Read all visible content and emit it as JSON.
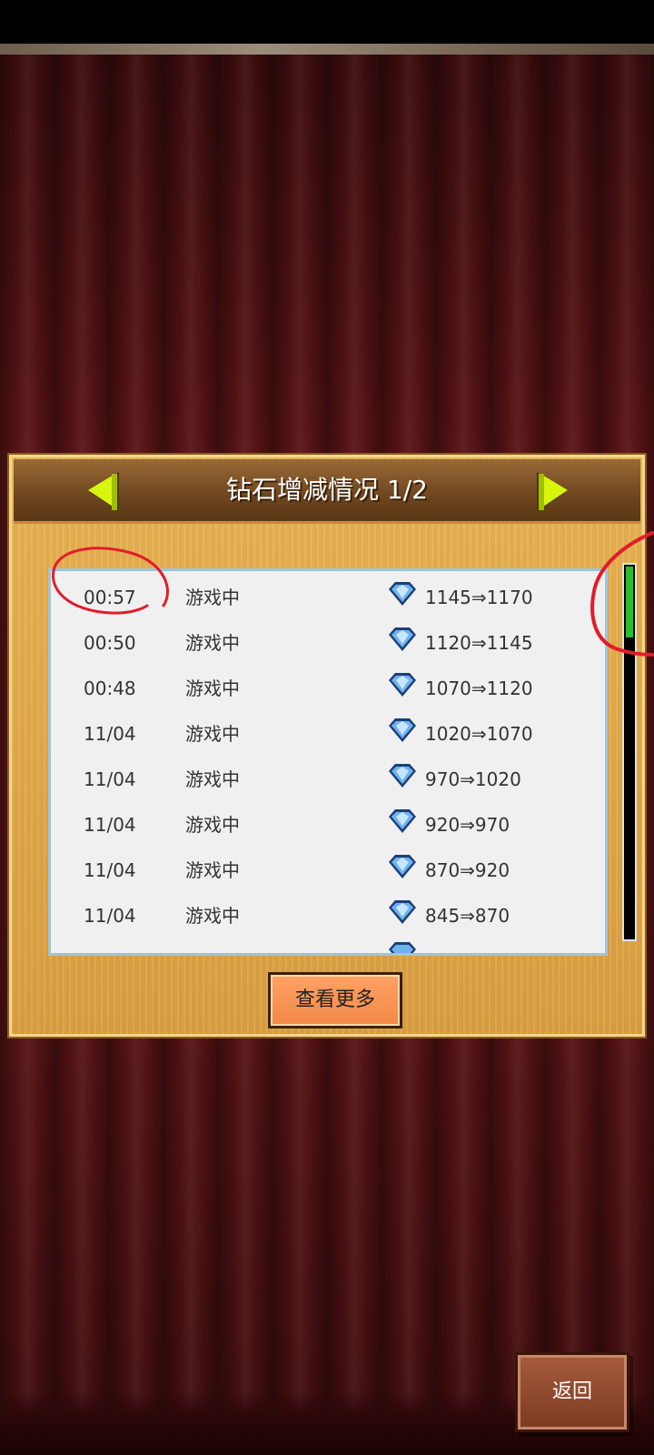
{
  "colors": {
    "accent_green": "#26c12c",
    "button_orange": "#f28a48",
    "annotation_red": "#e11d2a"
  },
  "panel": {
    "title": "钻石增减情况 1/2",
    "prev_icon": "arrow-left-icon",
    "next_icon": "arrow-right-icon"
  },
  "rows": [
    {
      "time": "00:57",
      "status": "游戏中",
      "icon": "diamond-icon",
      "change": "1145⇒1170"
    },
    {
      "time": "00:50",
      "status": "游戏中",
      "icon": "diamond-icon",
      "change": "1120⇒1145"
    },
    {
      "time": "00:48",
      "status": "游戏中",
      "icon": "diamond-icon",
      "change": "1070⇒1120"
    },
    {
      "time": "11/04",
      "status": "游戏中",
      "icon": "diamond-icon",
      "change": "1020⇒1070"
    },
    {
      "time": "11/04",
      "status": "游戏中",
      "icon": "diamond-icon",
      "change": "970⇒1020"
    },
    {
      "time": "11/04",
      "status": "游戏中",
      "icon": "diamond-icon",
      "change": "920⇒970"
    },
    {
      "time": "11/04",
      "status": "游戏中",
      "icon": "diamond-icon",
      "change": "870⇒920"
    },
    {
      "time": "11/04",
      "status": "游戏中",
      "icon": "diamond-icon",
      "change": "845⇒870"
    }
  ],
  "more_button": "查看更多",
  "back_button": "返回"
}
